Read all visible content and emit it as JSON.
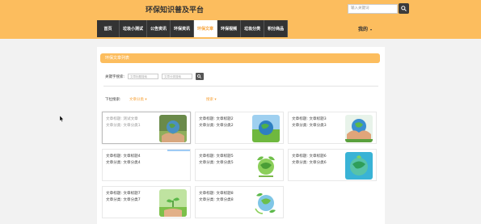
{
  "header": {
    "site_title": "环保知识普及平台",
    "search_placeholder": "输入关键词",
    "search_icon": "search-icon",
    "user_menu_label": "我的",
    "user_menu_caret": "▾"
  },
  "nav": {
    "items": [
      {
        "label": "首页",
        "active": false
      },
      {
        "label": "垃圾小测试",
        "active": false
      },
      {
        "label": "公告资讯",
        "active": false
      },
      {
        "label": "环保资讯",
        "active": false
      },
      {
        "label": "环保文章",
        "active": true
      },
      {
        "label": "环保视频",
        "active": false
      },
      {
        "label": "垃圾分类",
        "active": false
      },
      {
        "label": "积分商品",
        "active": false
      }
    ]
  },
  "panel": {
    "title": "环保文章列表",
    "search_label": "关键字搜索:",
    "filter1_placeholder": "文章标题搜索",
    "filter2_placeholder": "文章分类搜索",
    "filter_icon": "search-icon",
    "dropdown_label": "下拉搜索:",
    "dropdown1": "文章分类 ▾",
    "dropdown2": "搜索 ▾"
  },
  "cards": [
    {
      "title": "文章标题: 测试文章",
      "category": "文章分类: 文章分类1",
      "image": "hands-world-icon"
    },
    {
      "title": "文章标题: 文章标题2",
      "category": "文章分类: 文章分类2",
      "image": "globe-grass-icon"
    },
    {
      "title": "文章标题: 文章标题3",
      "category": "文章分类: 文章分类3",
      "image": "hands-globe-icon"
    },
    {
      "title": "文章标题: 文章标题4",
      "category": "文章分类: 文章分类4",
      "image": "loading-image"
    },
    {
      "title": "文章标题: 文章标题5",
      "category": "文章分类: 文章分类5",
      "image": "eco-globe-icon"
    },
    {
      "title": "文章标题: 文章标题6",
      "category": "文章分类: 文章分类6",
      "image": "green-earth-icon"
    },
    {
      "title": "文章标题: 文章标题7",
      "category": "文章分类: 文章分类7",
      "image": "seedling-hand-icon"
    },
    {
      "title": "文章标题: 文章标题8",
      "category": "文章分类: 文章分类8",
      "image": "leaf-globe-icon"
    }
  ],
  "colors": {
    "header_bg": "#fcbd5e",
    "accent": "#f7a33a",
    "nav_bg": "#333333"
  }
}
